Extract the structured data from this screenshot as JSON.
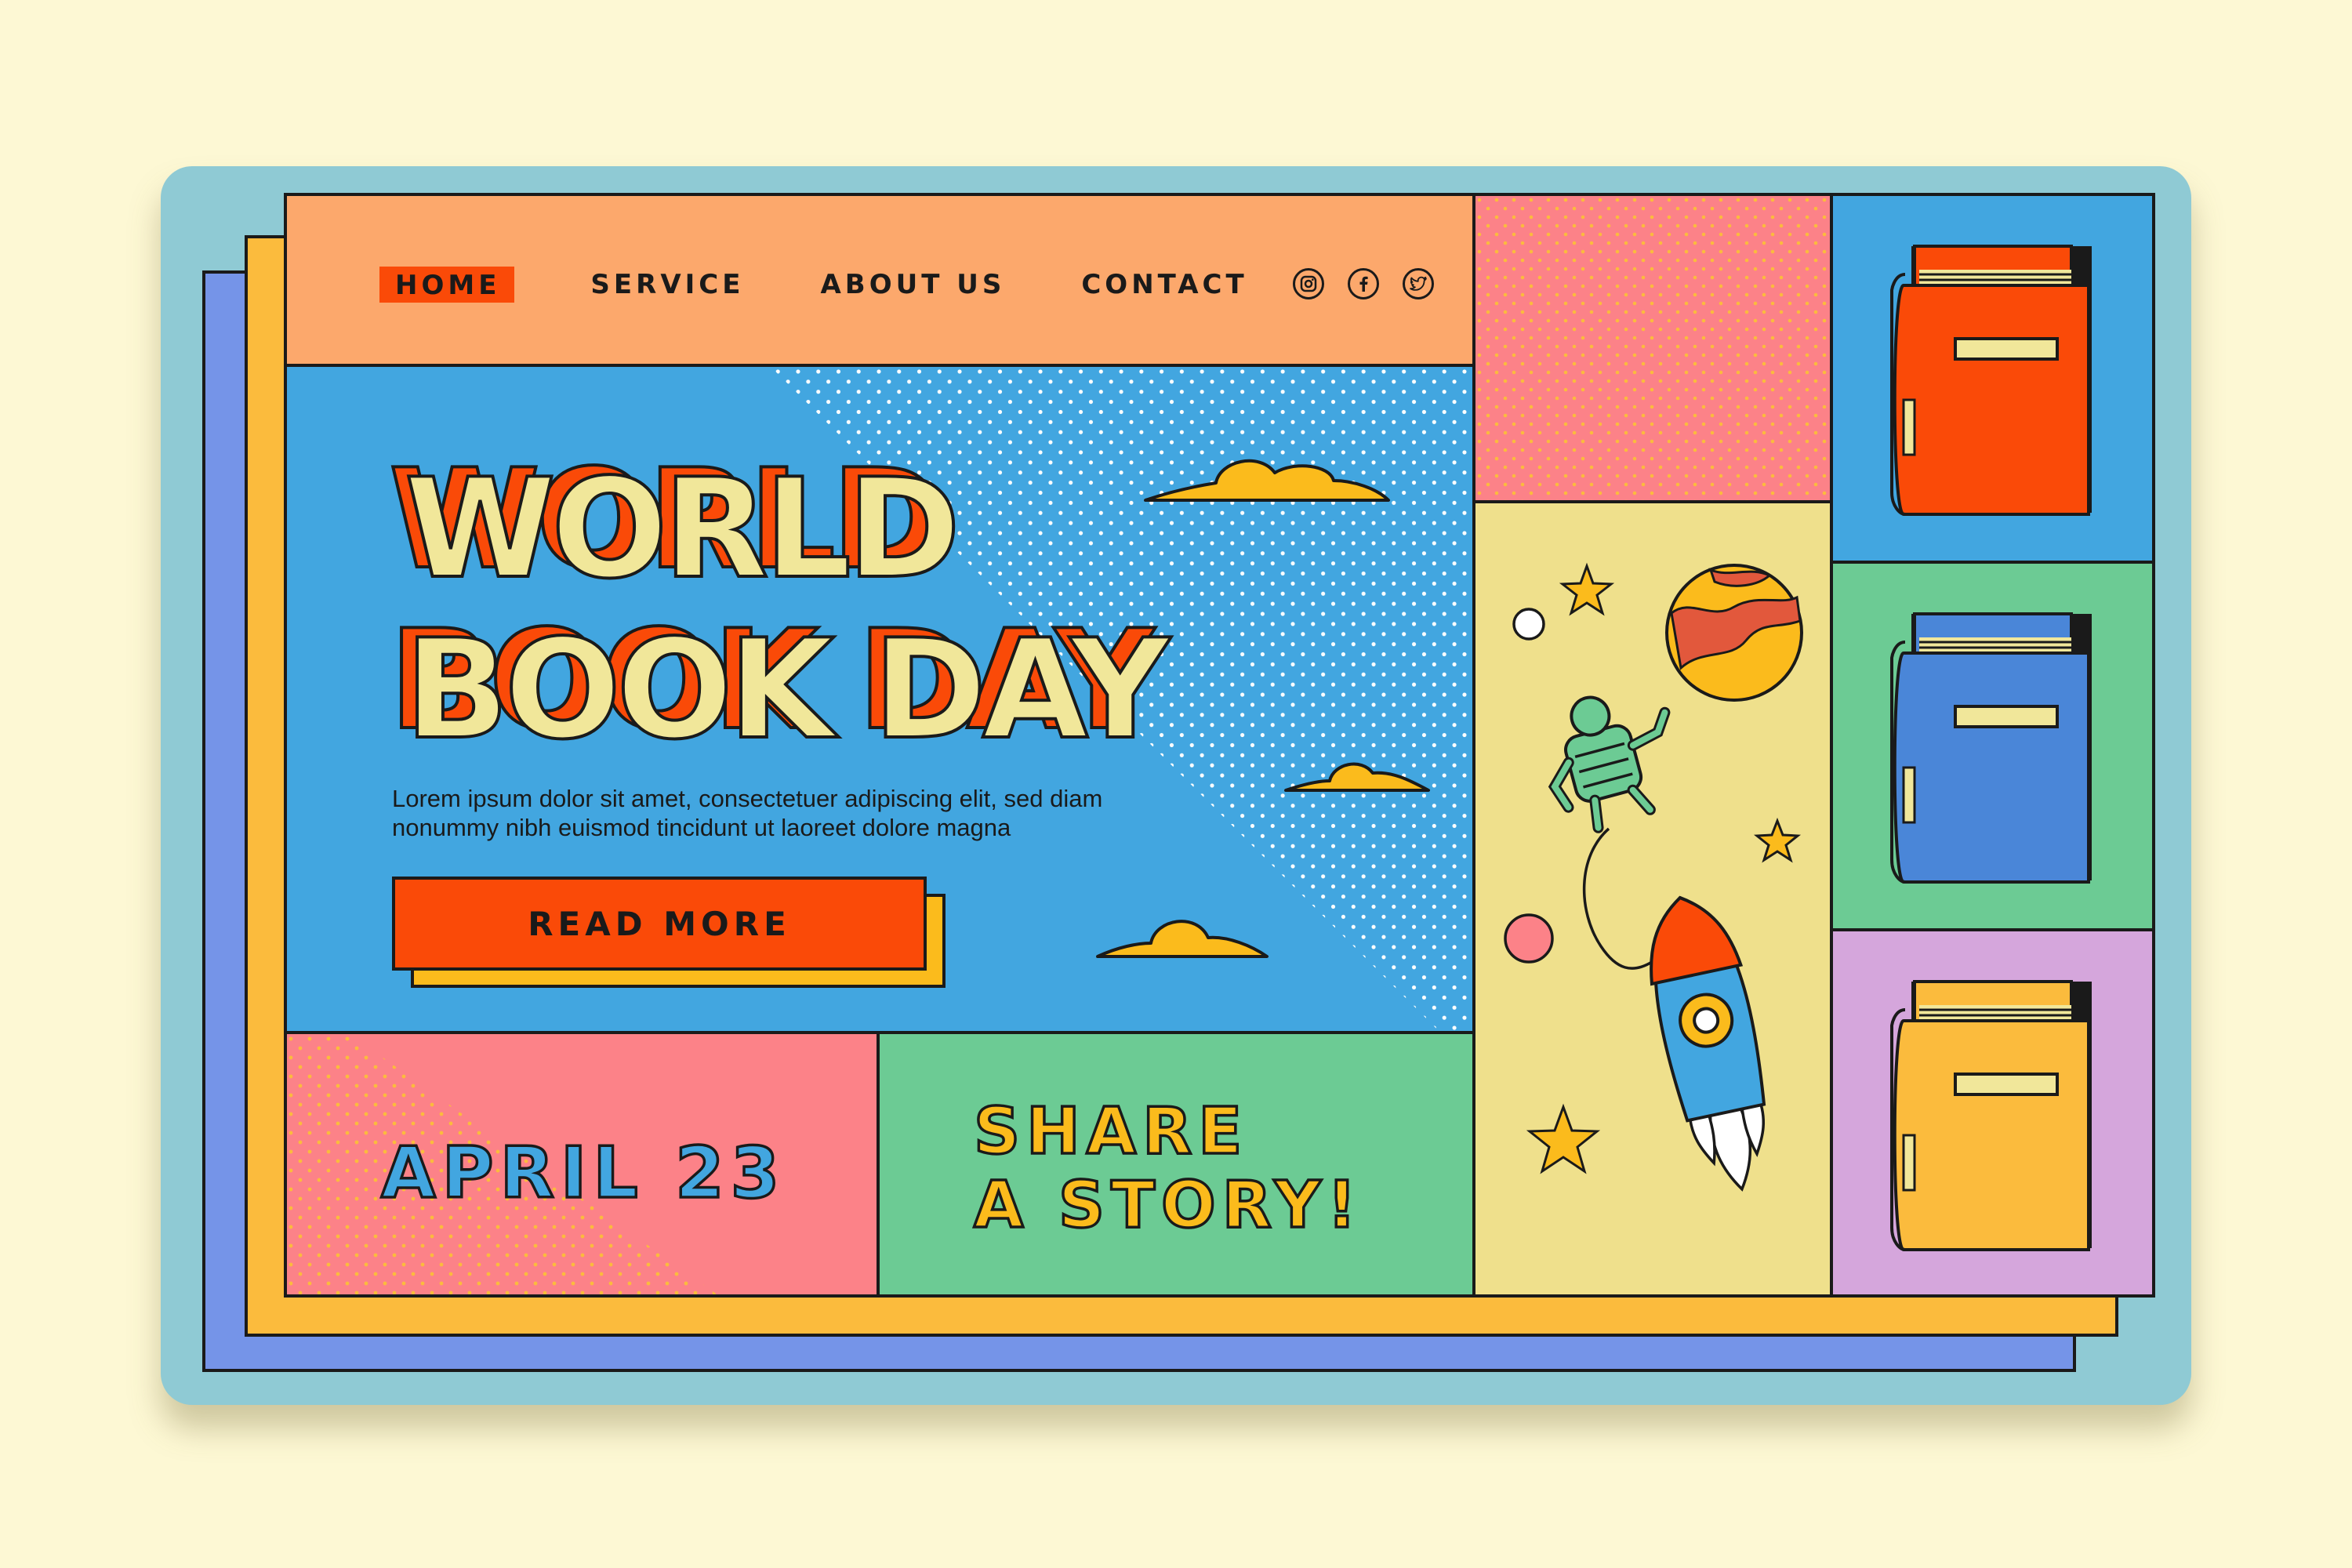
{
  "nav": {
    "items": [
      "HOME",
      "SERVICE",
      "ABOUT US",
      "CONTACT"
    ],
    "active": "HOME",
    "socials": [
      "instagram-icon",
      "facebook-icon",
      "twitter-icon"
    ]
  },
  "hero": {
    "title_line1": "WORLD",
    "title_line2": "BOOK DAY",
    "body_line1": "Lorem ipsum dolor sit amet, consectetuer adipiscing elit, sed diam",
    "body_line2": "nonummy nibh euismod tincidunt ut laoreet dolore magna",
    "cta_label": "READ MORE"
  },
  "date_panel": {
    "label": "APRIL 23"
  },
  "story_panel": {
    "line1": "SHARE",
    "line2": "A STORY!"
  },
  "space_panel": {
    "icons": [
      "planet-icon",
      "robot-icon",
      "rocket-icon",
      "star-icon",
      "moon-icon"
    ]
  },
  "book_panels": {
    "icons": [
      "red-book-icon",
      "blue-book-icon",
      "yellow-book-icon"
    ]
  },
  "colors": {
    "background": "#fdf8d4",
    "outer_card": "#8fcad4",
    "nav": "#fca86c",
    "hero": "#42a6e0",
    "accent_red": "#fa4a08",
    "accent_yellow": "#fbbb1c",
    "title_fill": "#f1e79a",
    "pink": "#fc8288",
    "green": "#6ccb94",
    "lavender": "#d5a6dc",
    "sand": "#efe08c"
  }
}
